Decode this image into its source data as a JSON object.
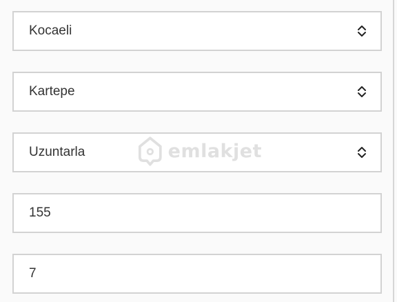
{
  "form": {
    "fields": [
      {
        "type": "select",
        "value": "Kocaeli"
      },
      {
        "type": "select",
        "value": "Kartepe"
      },
      {
        "type": "select",
        "value": "Uzuntarla"
      },
      {
        "type": "input",
        "value": "155"
      },
      {
        "type": "input",
        "value": "7"
      }
    ]
  },
  "watermark": {
    "text": "emlakjet",
    "icon": "house-location-icon"
  },
  "colors": {
    "border": "#d2d2d2",
    "text": "#333333",
    "watermark": "#c8c8c8"
  }
}
